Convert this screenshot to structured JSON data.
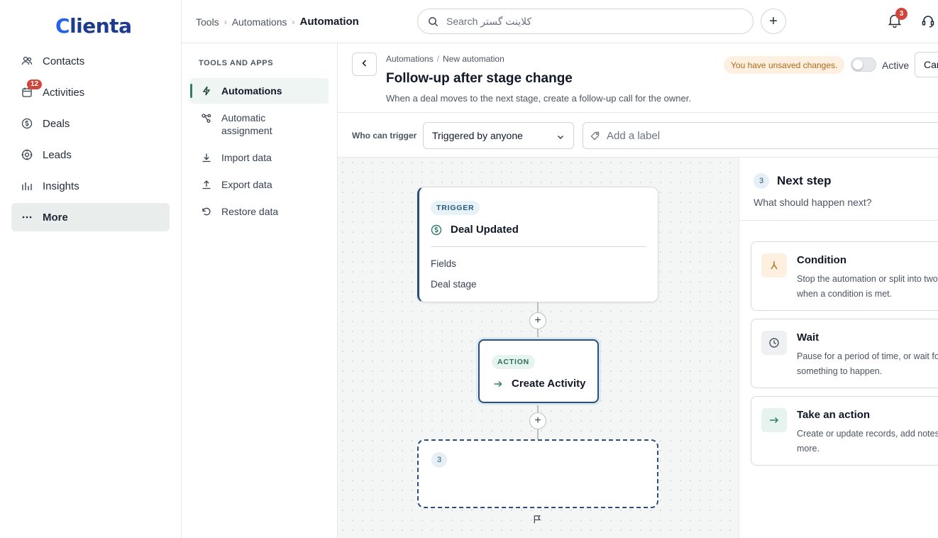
{
  "brand": {
    "logo_c": "C",
    "logo_rest": "lienta"
  },
  "nav": {
    "items": [
      {
        "label": "Contacts"
      },
      {
        "label": "Activities",
        "badge": "12"
      },
      {
        "label": "Deals"
      },
      {
        "label": "Leads"
      },
      {
        "label": "Insights"
      },
      {
        "label": "More"
      }
    ]
  },
  "topbar": {
    "breadcrumb": [
      "Tools",
      "Automations",
      "Automation"
    ],
    "search_placeholder": "Search کلاینت گستر",
    "notification_count": "3"
  },
  "subnav": {
    "heading": "TOOLS AND APPS",
    "items": [
      {
        "label": "Automations"
      },
      {
        "label": "Automatic assignment"
      },
      {
        "label": "Import data"
      },
      {
        "label": "Export data"
      },
      {
        "label": "Restore data"
      }
    ]
  },
  "header": {
    "breadcrumb": [
      "Automations",
      "New automation"
    ],
    "title": "Follow-up after stage change",
    "description": "When a deal moves to the next stage, create a follow-up call for the owner.",
    "unsaved": "You have unsaved changes.",
    "active_label": "Active",
    "active_on": false,
    "cancel_label": "Cancel"
  },
  "filters": {
    "who_label": "Who can trigger",
    "who_value": "Triggered by anyone",
    "label_placeholder": "Add a label"
  },
  "flow": {
    "trigger": {
      "tag": "TRIGGER",
      "title": "Deal Updated",
      "field_heading": "Fields",
      "field_value": "Deal stage"
    },
    "action": {
      "tag": "ACTION",
      "title": "Create Activity"
    },
    "empty_step": "3"
  },
  "panel": {
    "step": "3",
    "title": "Next step",
    "subtitle": "What should happen next?",
    "options": [
      {
        "title": "Condition",
        "desc": "Stop the automation or split into two paths when a condition is met."
      },
      {
        "title": "Wait",
        "desc": "Pause for a period of time, or wait for something to happen."
      },
      {
        "title": "Take an action",
        "desc": "Create or update records, add notes and more."
      }
    ]
  },
  "colors": {
    "accent": "#2e7d66",
    "badge": "#d1453b",
    "node_border": "#2c4e7a",
    "warning_bg": "#fdf0e1"
  }
}
